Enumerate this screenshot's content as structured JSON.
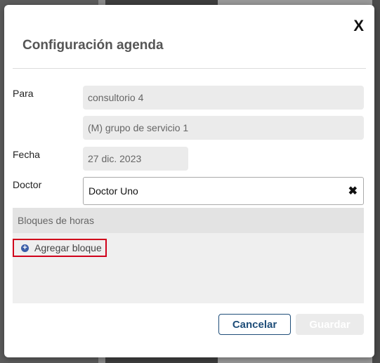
{
  "dialog": {
    "title": "Configuración agenda",
    "close_label": "X"
  },
  "form": {
    "para_label": "Para",
    "para_value_1": "consultorio 4",
    "para_value_2": "(M) grupo de servicio 1",
    "fecha_label": "Fecha",
    "fecha_value": "27 dic. 2023",
    "doctor_label": "Doctor",
    "doctor_value": "Doctor Uno",
    "doctor_clear": "✖"
  },
  "blocks": {
    "header": "Bloques de horas",
    "add_label": "Agregar bloque",
    "add_icon": "plus-circle-icon"
  },
  "footer": {
    "cancel_label": "Cancelar",
    "save_label": "Guardar"
  },
  "colors": {
    "highlight": "#d0021b",
    "primary": "#1f4e79",
    "icon": "#3b5ea8"
  }
}
